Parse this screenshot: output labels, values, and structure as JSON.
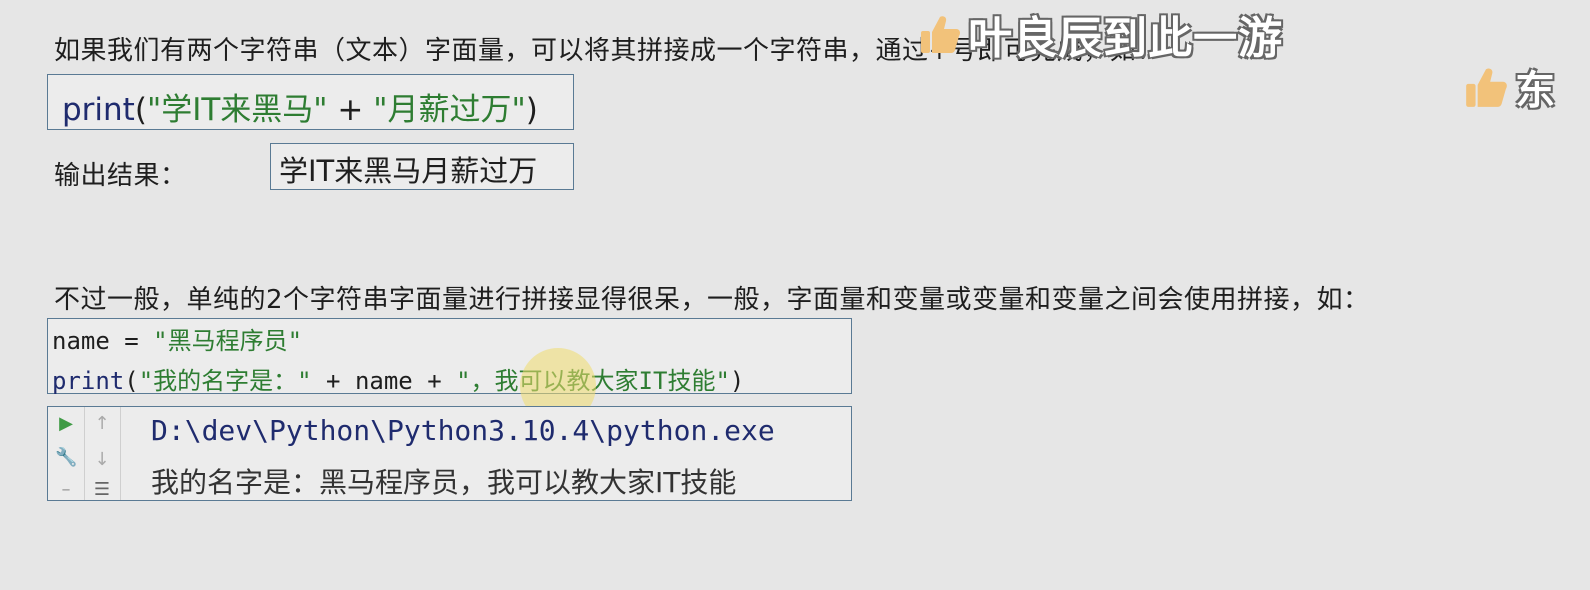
{
  "intro_text": "如果我们有两个字符串（文本）字面量，可以将其拼接成一个字符串，通过+号即可完成，如：",
  "code1": {
    "fn": "print",
    "open": "(",
    "str1": "\"学IT来黑马\"",
    "plus": " + ",
    "str2": "\"月薪过万\"",
    "close": ")"
  },
  "output_label": "输出结果：",
  "output1": "学IT来黑马月薪过万",
  "para2": "不过一般，单纯的2个字符串字面量进行拼接显得很呆，一般，字面量和变量或变量和变量之间会使用拼接，如：",
  "code2": {
    "line1_var": "name = ",
    "line1_str": "\"黑马程序员\"",
    "line2_fn": "print",
    "line2_open": "(",
    "line2_str1": "\"我的名字是：\"",
    "line2_mid": " + name + ",
    "line2_str2": "\"，我可以教大家IT技能\"",
    "line2_close": ")"
  },
  "console": {
    "path": "D:\\dev\\Python\\Python3.10.4\\python.exe",
    "output": "我的名字是：黑马程序员，我可以教大家IT技能",
    "icons": [
      "run-icon",
      "wrench-icon",
      "up-arrow-icon",
      "down-arrow-icon",
      "soft-wrap-icon"
    ]
  },
  "watermark": {
    "text1": "叶良辰到此一游",
    "text2": "东"
  },
  "colors": {
    "background": "#e6e6e6",
    "keyword": "#1f2b6e",
    "string": "#2e7d32",
    "box_border": "#5a7a94",
    "run_green": "#3f9b45"
  }
}
